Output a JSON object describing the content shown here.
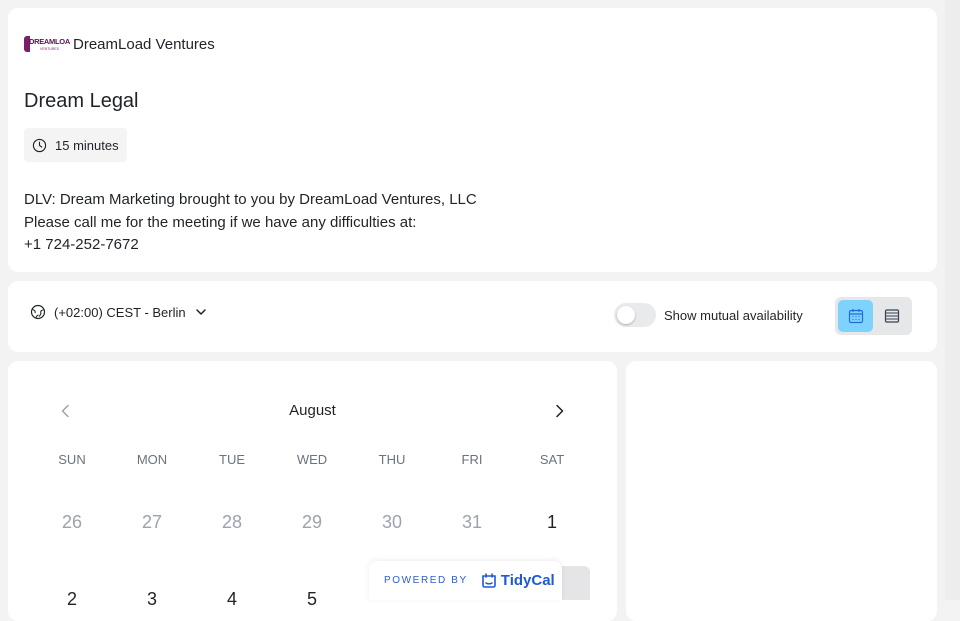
{
  "brand": {
    "name": "DreamLoad Ventures",
    "logo_text_main": "DREAMLOA",
    "logo_text_sub": "VENTURES"
  },
  "event": {
    "title": "Dream Legal",
    "duration": "15 minutes",
    "description": [
      "DLV: Dream Marketing brought to you by DreamLoad Ventures, LLC",
      "Please call me for the meeting if we have any difficulties at:",
      "+1 724-252-7672"
    ]
  },
  "controls": {
    "timezone": "(+02:00) CEST - Berlin",
    "mutual_availability_label": "Show mutual availability",
    "mutual_availability_on": false,
    "view_mode": "calendar",
    "accent_color": "#7dd3fc"
  },
  "calendar": {
    "month": "August",
    "weekdays": [
      "SUN",
      "MON",
      "TUE",
      "WED",
      "THU",
      "FRI",
      "SAT"
    ],
    "week1": [
      "26",
      "27",
      "28",
      "29",
      "30",
      "31",
      "1"
    ],
    "week2": [
      "2",
      "3",
      "4",
      "5"
    ]
  },
  "footer": {
    "powered_by": "POWERED BY",
    "product": "TidyCal",
    "color": "#1e5ad6"
  }
}
